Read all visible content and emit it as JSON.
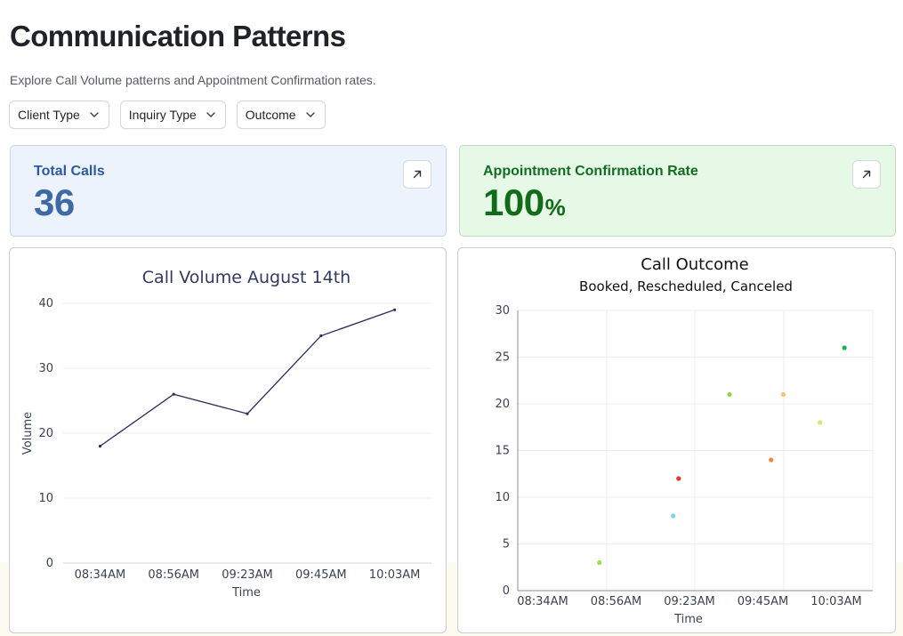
{
  "header": {
    "title": "Communication Patterns",
    "subtitle": "Explore Call Volume patterns and Appointment Confirmation rates."
  },
  "filters": [
    {
      "label": "Client Type",
      "icon": "chevron-down-icon"
    },
    {
      "label": "Inquiry Type",
      "icon": "chevron-down-icon"
    },
    {
      "label": "Outcome",
      "icon": "chevron-down-icon"
    }
  ],
  "kpis": {
    "total_calls": {
      "label": "Total Calls",
      "value": "36",
      "icon": "external-link-icon",
      "color": "#3d6aa7",
      "background": "#edf3fd"
    },
    "confirmation_rate": {
      "label": "Appointment Confirmation Rate",
      "value": "100",
      "unit": "%",
      "icon": "external-link-icon",
      "color": "#126b1a",
      "background": "#e6f8e6"
    }
  },
  "chart_data": [
    {
      "type": "line",
      "title": "Call Volume August 14th",
      "xlabel": "Time",
      "ylabel": "Volume",
      "x": [
        "08:34AM",
        "08:56AM",
        "09:23AM",
        "09:45AM",
        "10:03AM"
      ],
      "y_ticks": [
        0,
        10,
        20,
        30,
        40
      ],
      "ylim": [
        0,
        40
      ],
      "series": [
        {
          "values": [
            18,
            26,
            23,
            35,
            39
          ],
          "color": "#2a2f5a"
        }
      ],
      "grid": "horizontal",
      "legend": "none"
    },
    {
      "type": "scatter",
      "title": "Call Outcome",
      "subtitle": "Booked, Rescheduled, Canceled",
      "xlabel": "Time",
      "ylabel": "",
      "x_ticks": [
        "08:34AM",
        "08:56AM",
        "09:23AM",
        "09:45AM",
        "10:03AM"
      ],
      "y_ticks": [
        0,
        5,
        10,
        15,
        20,
        25,
        30
      ],
      "ylim": [
        0,
        30
      ],
      "grid": "both",
      "legend": "none",
      "points": [
        {
          "x": "08:51AM",
          "y": 3,
          "color": "#9be04f"
        },
        {
          "x": "09:17AM",
          "y": 8,
          "color": "#7fd3f0"
        },
        {
          "x": "09:19AM",
          "y": 12,
          "color": "#de3b2c"
        },
        {
          "x": "09:35AM",
          "y": 21,
          "color": "#8fd64c"
        },
        {
          "x": "09:47AM",
          "y": 14,
          "color": "#f08a3a"
        },
        {
          "x": "09:50AM",
          "y": 21,
          "color": "#f9c46a"
        },
        {
          "x": "09:59AM",
          "y": 18,
          "color": "#d2e86a"
        },
        {
          "x": "10:05AM",
          "y": 26,
          "color": "#19b35a"
        }
      ]
    }
  ]
}
